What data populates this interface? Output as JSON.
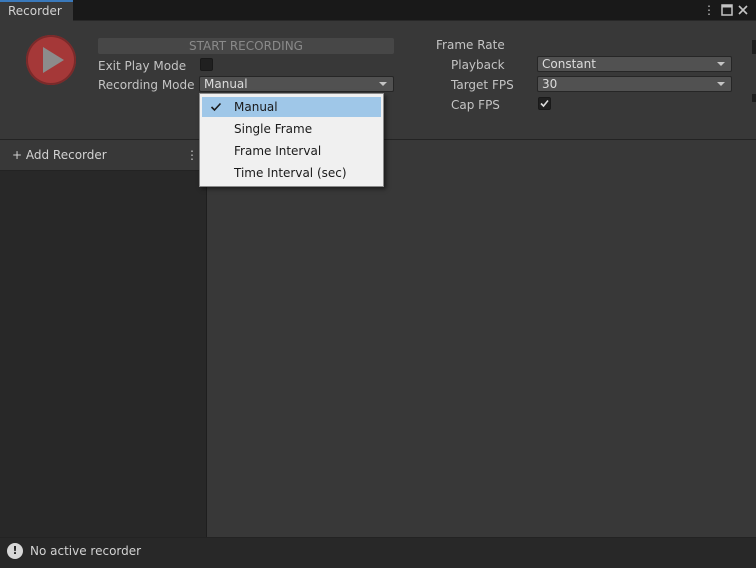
{
  "window": {
    "tab_label": "Recorder",
    "icons": [
      "more-vert-icon",
      "maximize-icon",
      "close-icon"
    ]
  },
  "recording": {
    "start_label": "START RECORDING",
    "exit_play_mode_label": "Exit Play Mode",
    "exit_play_mode_checked": false,
    "recording_mode_label": "Recording Mode",
    "recording_mode_value": "Manual"
  },
  "frame_rate": {
    "header": "Frame Rate",
    "playback_label": "Playback",
    "playback_value": "Constant",
    "target_fps_label": "Target FPS",
    "target_fps_value": "30",
    "cap_fps_label": "Cap FPS",
    "cap_fps_checked": true
  },
  "recorder_list": {
    "add_label": "+ Add Recorder"
  },
  "mode_menu": {
    "options": [
      {
        "label": "Manual",
        "selected": true
      },
      {
        "label": "Single Frame",
        "selected": false
      },
      {
        "label": "Frame Interval",
        "selected": false
      },
      {
        "label": "Time Interval (sec)",
        "selected": false
      }
    ]
  },
  "status": {
    "icon": "info-icon",
    "text": "No active recorder"
  },
  "colors": {
    "record_button": "#a53838",
    "tab_accent": "#3a79bb",
    "menu_selection": "#9fc7e8"
  }
}
